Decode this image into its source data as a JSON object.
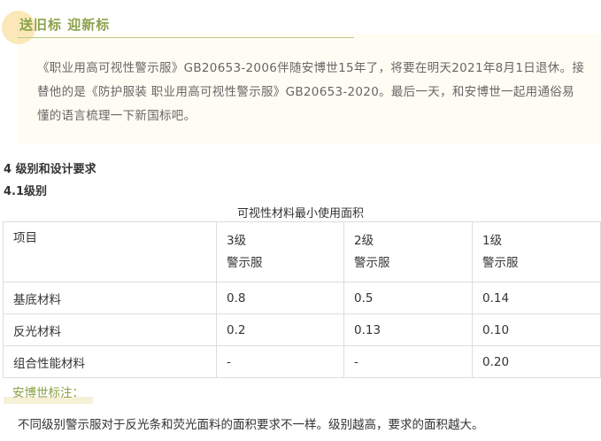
{
  "section": {
    "title": "送旧标 迎新标"
  },
  "intro": {
    "text": "《职业用高可视性警示服》GB20653-2006伴随安博世15年了，将要在明天2021年8月1日退休。接替他的是《防护服装 职业用高可视性警示服》GB20653-2020。最后一天，和安博世一起用通俗易懂的语言梳理一下新国标吧。"
  },
  "headings": {
    "h1": "4 级别和设计要求",
    "h2": "4.1级别"
  },
  "table": {
    "caption": "可视性材料最小使用面积",
    "header": [
      {
        "line1": "项目",
        "line2": ""
      },
      {
        "line1": "3级",
        "line2": "警示服"
      },
      {
        "line1": "2级",
        "line2": "警示服"
      },
      {
        "line1": "1级",
        "line2": "警示服"
      }
    ],
    "rows": [
      [
        "基底材料",
        "0.8",
        "0.5",
        "0.14"
      ],
      [
        "反光材料",
        "0.2",
        "0.13",
        "0.10"
      ],
      [
        "组合性能材料",
        "-",
        "-",
        "0.20"
      ]
    ]
  },
  "note": {
    "label": "安博世标注：",
    "text": "不同级别警示服对于反光条和荧光面料的面积要求不一样。级别越高，要求的面积越大。"
  }
}
